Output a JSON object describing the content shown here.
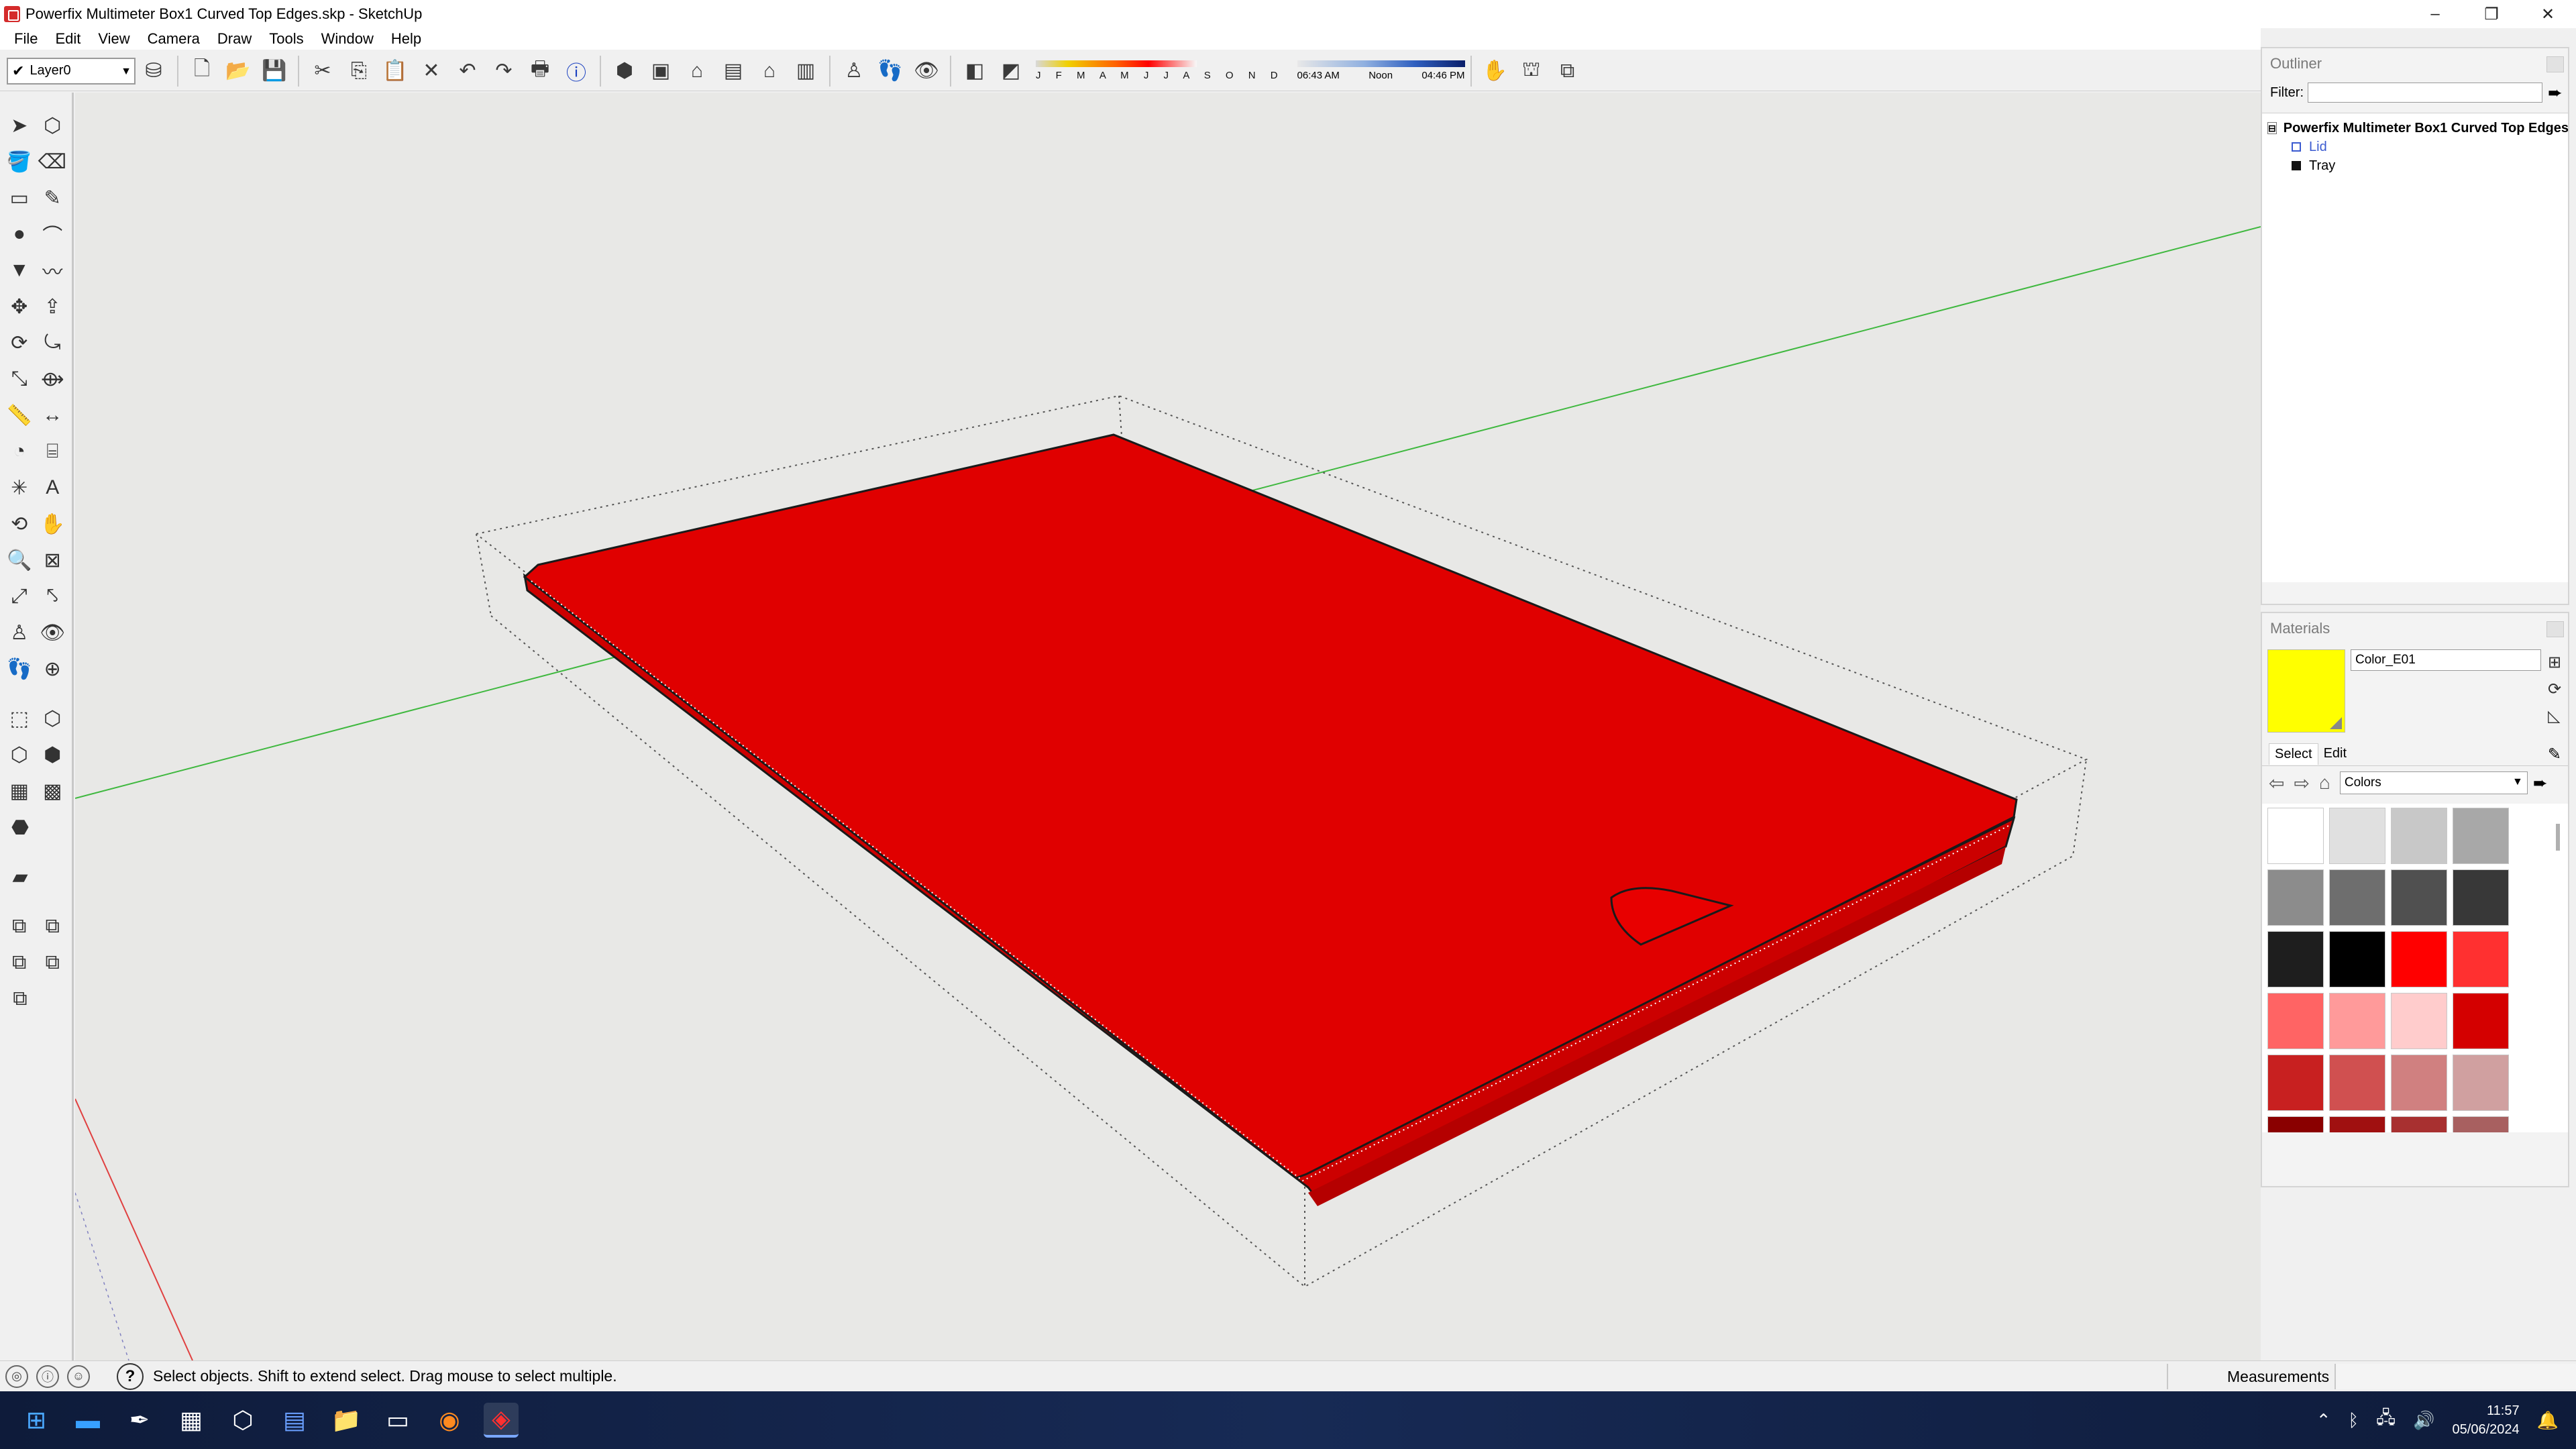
{
  "window": {
    "title": "Powerfix Multimeter Box1 Curved Top Edges.skp - SketchUp",
    "controls": {
      "minimize": "–",
      "restore": "❐",
      "close": "✕"
    }
  },
  "menu": [
    "File",
    "Edit",
    "View",
    "Camera",
    "Draw",
    "Tools",
    "Window",
    "Help"
  ],
  "toolbar": {
    "layer": "Layer0",
    "shadow_months": "J F M A M J J A S O N D",
    "time_start": "06:43 AM",
    "time_mid": "Noon",
    "time_end": "04:46 PM"
  },
  "outliner": {
    "title": "Outliner",
    "filter_label": "Filter:",
    "root": "Powerfix Multimeter Box1 Curved Top Edges",
    "items": [
      "Lid",
      "Tray"
    ]
  },
  "materials": {
    "title": "Materials",
    "current_name": "Color_E01",
    "current_color": "#ffff00",
    "tabs": [
      "Select",
      "Edit"
    ],
    "library": "Colors",
    "swatches": [
      [
        "#ffffff",
        "#e0e0e0",
        "#c8c8c8",
        "#a8a8a8"
      ],
      [
        "#8c8c8c",
        "#6e6e6e",
        "#505050",
        "#383838"
      ],
      [
        "#1e1e1e",
        "#000000",
        "#ff0000",
        "#ff3030"
      ],
      [
        "#ff6464",
        "#ff9a9a",
        "#ffcccc",
        "#d40000"
      ],
      [
        "#c82020",
        "#d05050",
        "#d08080",
        "#d0a0a0"
      ],
      [
        "#8a0000",
        "#a01010",
        "#a83030",
        "#a86060"
      ]
    ]
  },
  "status": {
    "text": "Select objects. Shift to extend select. Drag mouse to select multiple.",
    "measurements_label": "Measurements"
  },
  "taskbar": {
    "time": "11:57",
    "date": "05/06/2024"
  },
  "model_color": "#e00000"
}
